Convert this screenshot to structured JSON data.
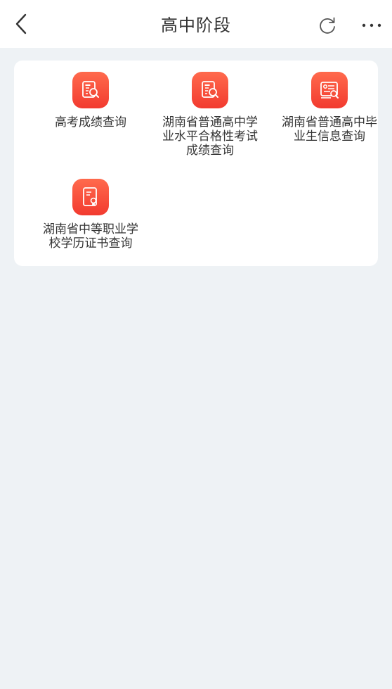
{
  "header": {
    "title": "高中阶段",
    "back_icon": "chevron-left-icon",
    "refresh_icon": "refresh-icon",
    "more_icon": "more-horizontal-icon"
  },
  "colors": {
    "background": "#EEF2F5",
    "icon_gradient_top": "#FF6A4D",
    "icon_gradient_bottom": "#F23A2F",
    "text": "#333333"
  },
  "services": [
    {
      "label_lines": [
        "高考成绩查询"
      ],
      "icon": "exam-score-search-icon"
    },
    {
      "label_lines": [
        "湖南省普通高中学",
        "业水平合格性考试",
        "成绩查询"
      ],
      "icon": "exam-score-search-icon"
    },
    {
      "label_lines": [
        "湖南省普通高中毕",
        "业生信息查询"
      ],
      "icon": "graduate-info-search-icon"
    },
    {
      "label_lines": [
        "湖南省中等职业学",
        "校学历证书查询"
      ],
      "icon": "certificate-icon"
    }
  ]
}
